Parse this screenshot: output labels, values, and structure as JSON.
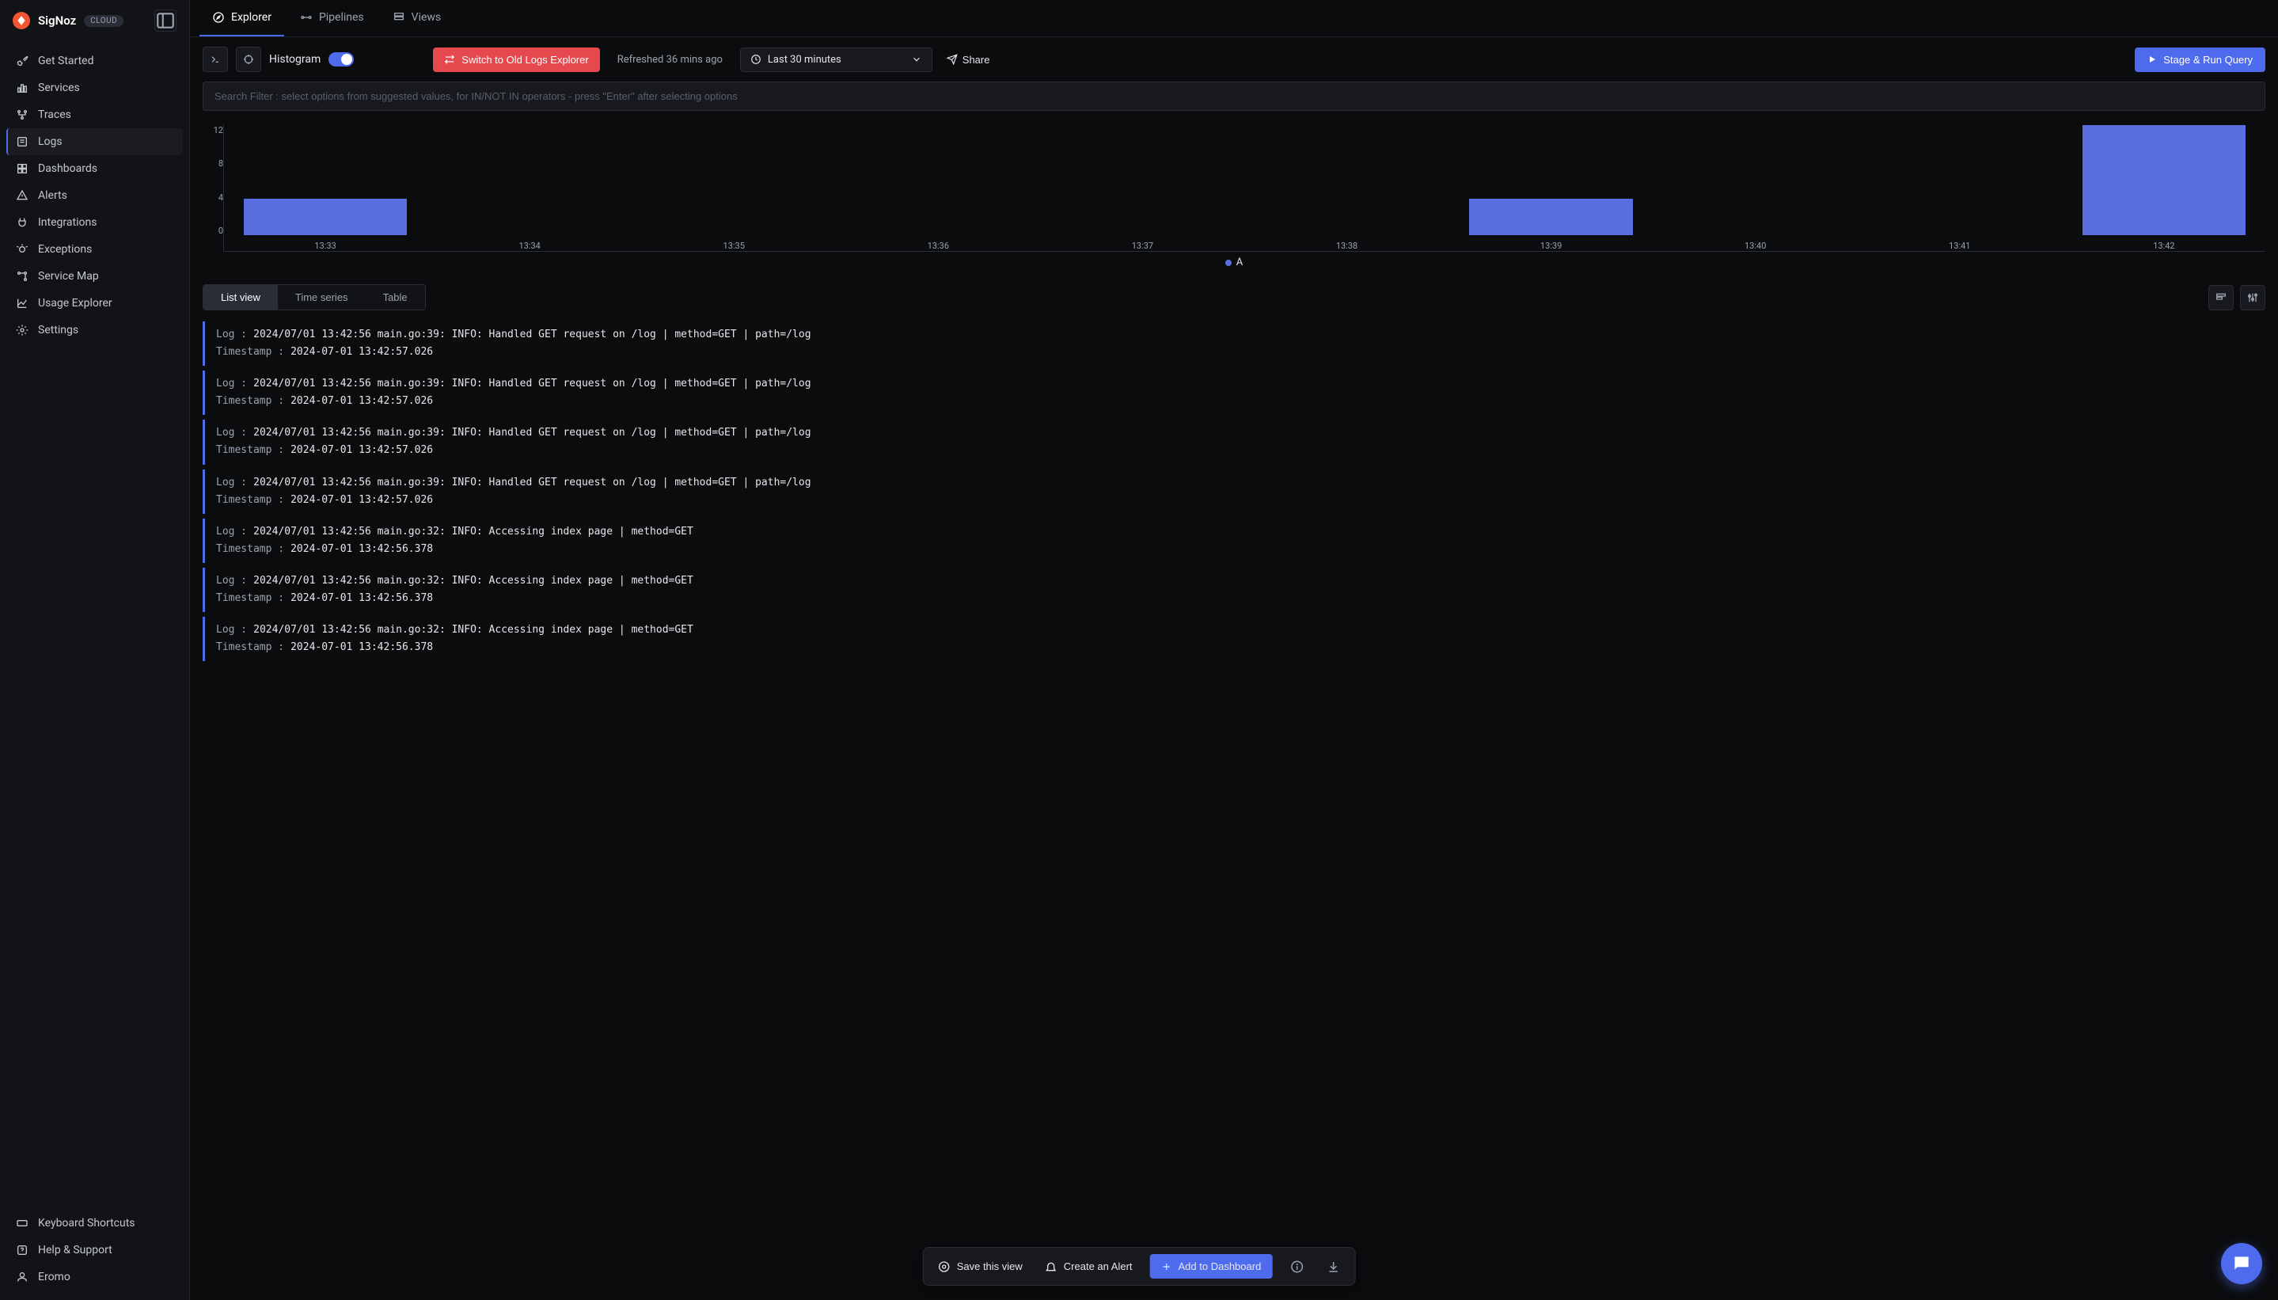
{
  "brand": "SigNoz",
  "cloud_badge": "CLOUD",
  "sidebar": {
    "items": [
      {
        "label": "Get Started",
        "icon": "rocket"
      },
      {
        "label": "Services",
        "icon": "bars"
      },
      {
        "label": "Traces",
        "icon": "hierarchy"
      },
      {
        "label": "Logs",
        "icon": "logs"
      },
      {
        "label": "Dashboards",
        "icon": "grid"
      },
      {
        "label": "Alerts",
        "icon": "alert"
      },
      {
        "label": "Integrations",
        "icon": "plug"
      },
      {
        "label": "Exceptions",
        "icon": "bug"
      },
      {
        "label": "Service Map",
        "icon": "map"
      },
      {
        "label": "Usage Explorer",
        "icon": "chart"
      },
      {
        "label": "Settings",
        "icon": "gear"
      }
    ],
    "footer": [
      {
        "label": "Keyboard Shortcuts",
        "icon": "keyboard"
      },
      {
        "label": "Help & Support",
        "icon": "help"
      },
      {
        "label": "Eromo",
        "icon": "user"
      }
    ]
  },
  "tabs": [
    {
      "label": "Explorer",
      "icon": "compass"
    },
    {
      "label": "Pipelines",
      "icon": "pipeline"
    },
    {
      "label": "Views",
      "icon": "views"
    }
  ],
  "toolbar": {
    "histogram_label": "Histogram",
    "switch_old": "Switch to Old Logs Explorer",
    "refreshed": "Refreshed 36 mins ago",
    "time_range": "Last 30 minutes",
    "share_label": "Share",
    "run_label": "Stage & Run Query"
  },
  "search": {
    "placeholder": "Search Filter : select options from suggested values, for IN/NOT IN operators - press \"Enter\" after selecting options"
  },
  "chart_data": {
    "type": "bar",
    "categories": [
      "13:33",
      "13:34",
      "13:35",
      "13:36",
      "13:37",
      "13:38",
      "13:39",
      "13:40",
      "13:41",
      "13:42"
    ],
    "values": [
      4,
      0,
      0,
      0,
      0,
      0,
      4,
      0,
      0,
      12
    ],
    "ylabel": "",
    "y_ticks": [
      "12",
      "8",
      "4",
      "0"
    ],
    "ylim": [
      0,
      12
    ],
    "legend": "A"
  },
  "view_tabs": [
    "List view",
    "Time series",
    "Table"
  ],
  "log_labels": {
    "log": "Log :",
    "ts": "Timestamp :"
  },
  "logs": [
    {
      "log": "2024/07/01 13:42:56 main.go:39: INFO: Handled GET request on /log | method=GET | path=/log",
      "ts": "2024-07-01 13:42:57.026"
    },
    {
      "log": "2024/07/01 13:42:56 main.go:39: INFO: Handled GET request on /log | method=GET | path=/log",
      "ts": "2024-07-01 13:42:57.026"
    },
    {
      "log": "2024/07/01 13:42:56 main.go:39: INFO: Handled GET request on /log | method=GET | path=/log",
      "ts": "2024-07-01 13:42:57.026"
    },
    {
      "log": "2024/07/01 13:42:56 main.go:39: INFO: Handled GET request on /log | method=GET | path=/log",
      "ts": "2024-07-01 13:42:57.026"
    },
    {
      "log": "2024/07/01 13:42:56 main.go:32: INFO: Accessing index page | method=GET",
      "ts": "2024-07-01 13:42:56.378"
    },
    {
      "log": "2024/07/01 13:42:56 main.go:32: INFO: Accessing index page | method=GET",
      "ts": "2024-07-01 13:42:56.378"
    },
    {
      "log": "2024/07/01 13:42:56 main.go:32: INFO: Accessing index page | method=GET",
      "ts": "2024-07-01 13:42:56.378"
    }
  ],
  "float_bar": {
    "save_view": "Save this view",
    "create_alert": "Create an Alert",
    "add_dashboard": "Add to Dashboard"
  }
}
